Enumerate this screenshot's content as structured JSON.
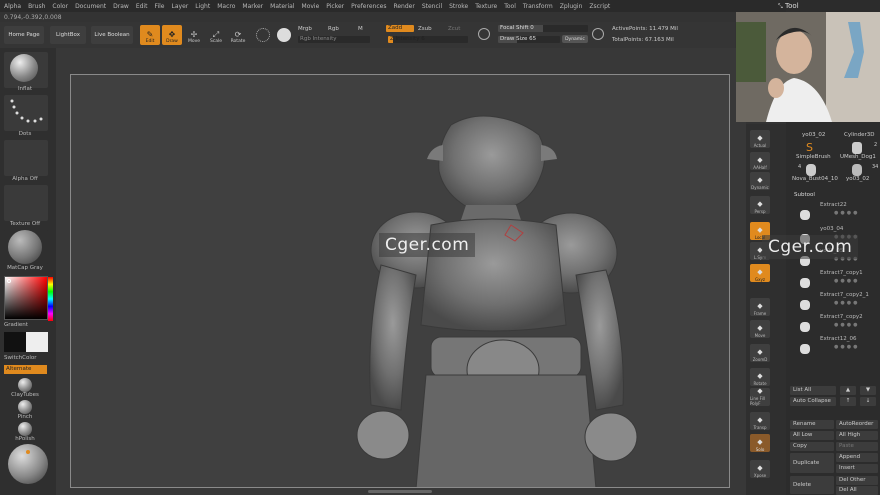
{
  "menu": [
    "Alpha",
    "Brush",
    "Color",
    "Document",
    "Draw",
    "Edit",
    "File",
    "Layer",
    "Light",
    "Macro",
    "Marker",
    "Material",
    "Movie",
    "Picker",
    "Preferences",
    "Render",
    "Stencil",
    "Stroke",
    "Texture",
    "Tool",
    "Transform",
    "Zplugin",
    "Zscript"
  ],
  "coords": "0.794,-0.392,0.008",
  "toolbar": {
    "home": "Home Page",
    "lightbox": "LightBox",
    "live_boolean": "Live Boolean",
    "edit": "Edit",
    "draw": "Draw",
    "move": "Move",
    "scale": "Scale",
    "rotate": "Rotate",
    "mrgb": "Mrgb",
    "rgb": "Rgb",
    "m": "M",
    "zadd": "Zadd",
    "zsub": "Zsub",
    "zcut": "Zcut",
    "rgb_intensity": "Rgb Intensity",
    "z_intensity": "Z Intensity 6",
    "focal_shift": "Focal Shift 0",
    "draw_size": "Draw Size 65",
    "dynamic": "Dynamic",
    "active_points": "ActivePoints: 11.479 Mil",
    "total_points": "TotalPoints: 67.163 Mil"
  },
  "left_shelf": {
    "inflat": "Inflat",
    "dots": "Dots",
    "alpha_off": "Alpha Off",
    "texture_off": "Texture Off",
    "matcap": "MatCap Gray",
    "gradient": "Gradient",
    "switch_color": "SwitchColor",
    "alternate": "Alternate",
    "claytubes": "ClayTubes",
    "pinch": "Pinch",
    "hpolish": "hPolish"
  },
  "watermarks": [
    "Cger.com",
    "Cger.com"
  ],
  "tool_panel": {
    "title": "Tool",
    "items": [
      {
        "label": "yo03_02"
      },
      {
        "label": "Cylinder3D"
      },
      {
        "label": "SimpleBrush"
      },
      {
        "label": "UMesh_Dog1"
      },
      {
        "label": "Nova_Bust04_10"
      },
      {
        "label": "yo03_02"
      }
    ],
    "counts": [
      "2",
      "34",
      "4"
    ],
    "subtool_header": "Subtool",
    "subtools": [
      "Extract22",
      "yo03_04",
      "yo03_05",
      "Extract7_copy1",
      "Extract7_copy2_1",
      "Extract7_copy2",
      "Extract12_06"
    ],
    "list_all": "List All",
    "auto_collapse": "Auto Collapse",
    "rename": "Rename",
    "auto_reorder": "AutoReorder",
    "all_low": "All Low",
    "all_high": "All High",
    "copy": "Copy",
    "paste": "Paste",
    "append": "Append",
    "duplicate": "Duplicate",
    "insert": "Insert",
    "delete": "Delete",
    "del_other": "Del Other",
    "del_all": "Del All"
  },
  "right_shelf": [
    "Actual",
    "AAHalf",
    "Dynamic",
    "Persp",
    "Floor",
    "Local",
    "L.Sym",
    "Gxyz",
    "Frame",
    "Move",
    "ZoomD",
    "Rotate",
    "Line Fill PolyF",
    "Transp",
    "Solo",
    "Xpose"
  ],
  "colors": {
    "accent": "#e08a1e",
    "background": "#333333",
    "canvas": "#404040"
  }
}
